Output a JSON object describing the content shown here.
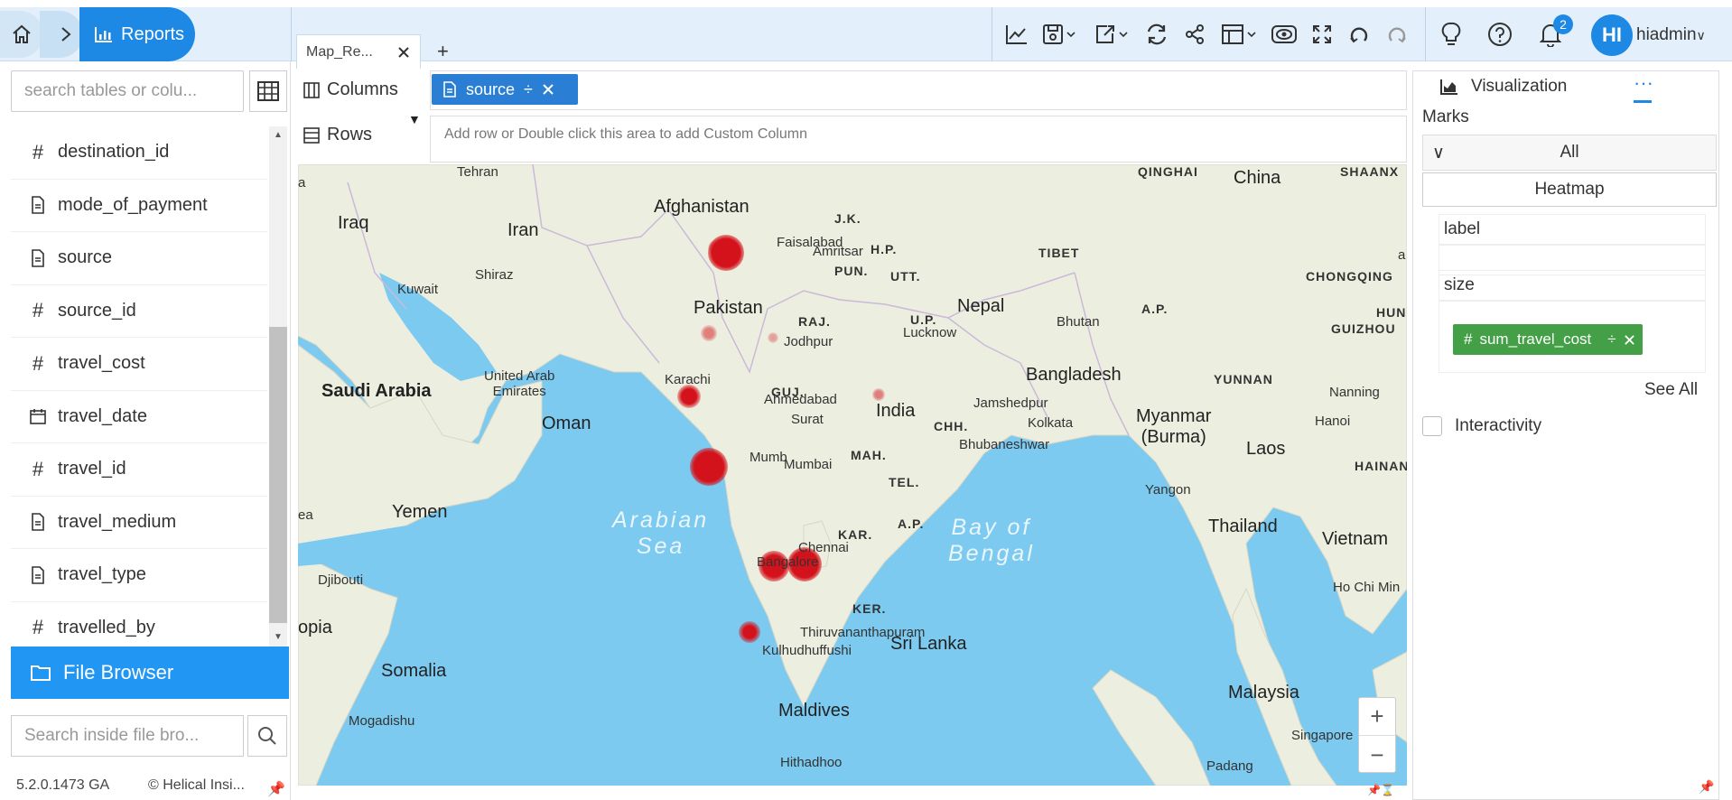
{
  "topbar": {
    "app_label": "Reports",
    "tab_title": "Map_Re...",
    "notification_count": "2",
    "user_initials": "HI",
    "user_name": "hiadmin"
  },
  "left_panel": {
    "search_placeholder": "search tables or colu...",
    "fields": [
      {
        "name": "destination_id",
        "type": "number"
      },
      {
        "name": "mode_of_payment",
        "type": "text"
      },
      {
        "name": "source",
        "type": "text"
      },
      {
        "name": "source_id",
        "type": "number"
      },
      {
        "name": "travel_cost",
        "type": "number"
      },
      {
        "name": "travel_date",
        "type": "date"
      },
      {
        "name": "travel_id",
        "type": "number"
      },
      {
        "name": "travel_medium",
        "type": "text"
      },
      {
        "name": "travel_type",
        "type": "text"
      },
      {
        "name": "travelled_by",
        "type": "number"
      }
    ],
    "file_browser_label": "File Browser",
    "file_search_placeholder": "Search inside file bro...",
    "version": "5.2.0.1473 GA",
    "copyright": "© Helical Insi..."
  },
  "shelves": {
    "columns_label": "Columns",
    "rows_label": "Rows",
    "column_pill": "source",
    "rows_hint": "Add row or Double click this area to add Custom Column"
  },
  "map": {
    "labels": {
      "iraq": "Iraq",
      "iran": "Iran",
      "afghanistan": "Afghanistan",
      "pakistan": "Pakistan",
      "china": "China",
      "nepal": "Nepal",
      "bhutan": "Bhutan",
      "india": "India",
      "bangladesh": "Bangladesh",
      "myanmar": "Myanmar\n(Burma)",
      "laos": "Laos",
      "thailand": "Thailand",
      "vietnam": "Vietnam",
      "saudi": "Saudi Arabia",
      "uae": "United Arab\nEmirates",
      "oman": "Oman",
      "yemen": "Yemen",
      "kuwait": "Kuwait",
      "shiraz": "Shiraz",
      "djibouti": "Djibouti",
      "somalia": "Somalia",
      "opia": "opia",
      "maldives": "Maldives",
      "srilanka": "Sri Lanka",
      "malaysia": "Malaysia",
      "singapore": "Singapore",
      "arabian_sea": "Arabian\nSea",
      "bay_of_bengal": "Bay of\nBengal",
      "qinghai": "QINGHAI",
      "tibet": "TIBET",
      "shaanx": "SHAANX",
      "chongqing": "CHONGQING",
      "guizhou": "GUIZHOU",
      "hun": "HUN",
      "yunnan": "YUNNAN",
      "hainan": "HAINAN",
      "ap_china": "A.P.",
      "jk": "J.K.",
      "hp": "H.P.",
      "pun": "PUN.",
      "utt": "UTT.",
      "raj": "RAJ.",
      "up": "U.P.",
      "guj": "GUJ.",
      "mah": "MAH.",
      "chh": "CHH.",
      "tel": "TEL.",
      "ap": "A.P.",
      "kar": "KAR.",
      "ker": "KER.",
      "tehran": "Tehran",
      "faisalabad": "Faisalabad",
      "amritsar": "Amritsar",
      "jodhpur": "Jodhpur",
      "lucknow": "Lucknow",
      "karachi": "Karachi",
      "ahmedabad": "Ahmedabad",
      "surat": "Surat",
      "mumbai": "Mumbai",
      "mumb": "Mumb",
      "jamshedpur": "Jamshedpur",
      "kolkata": "Kolkata",
      "bhubaneshwar": "Bhubaneshwar",
      "yangon": "Yangon",
      "hanoi": "Hanoi",
      "nanning": "Nanning",
      "hochiminh": "Ho Chi Min",
      "chennai": "Chennai",
      "bangalore": "Bangalore",
      "thiruvananthapuram": "Thiruvananthapuram",
      "kulhudhuffushi": "Kulhudhuffushi",
      "mogadishu": "Mogadishu",
      "hithadhoo": "Hithadhoo",
      "padang": "Padang",
      "a_edge": "a",
      "ea_edge": "ea",
      "edge_a": "a"
    }
  },
  "right_panel": {
    "tab_label": "Visualization",
    "more_label": "···",
    "marks_title": "Marks",
    "marks_selector": "All",
    "chart_type": "Heatmap",
    "label_slot": "label",
    "size_slot": "size",
    "size_pill": "sum_travel_cost",
    "see_all": "See All",
    "interactivity": "Interactivity"
  }
}
